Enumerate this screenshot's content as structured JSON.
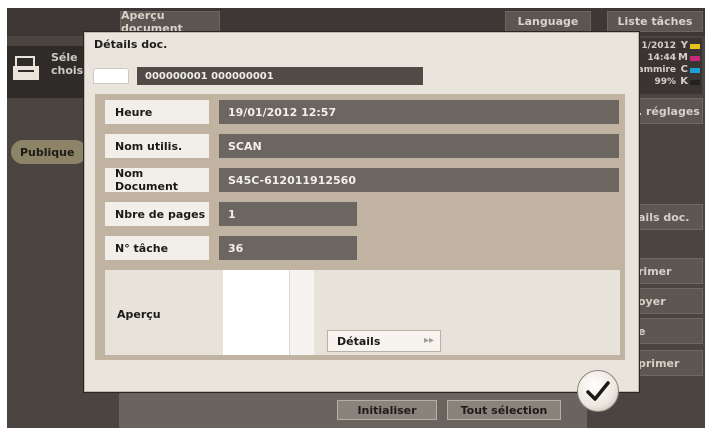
{
  "background": {
    "top_buttons": [
      "Aperçu document",
      "Language",
      "Liste tâches"
    ],
    "left_text": [
      "Séle",
      "choisi"
    ],
    "public_tab": "Publique",
    "status": {
      "lines": [
        "1/2012",
        "14:44",
        "ammire",
        "99%"
      ],
      "cmyk_labels": [
        "Y",
        "M",
        "C",
        "K"
      ],
      "cmyk_colors": [
        "#e6c21a",
        "#c8287a",
        "#1aa0d8",
        "#222222"
      ]
    },
    "right_buttons": [
      ". réglages",
      "ails doc.",
      "rimer",
      "oyer",
      "e",
      "primer"
    ],
    "bottom_buttons": [
      "Initialiser",
      "Tout sélection"
    ]
  },
  "dialog": {
    "title": "Détails doc.",
    "doc_id": "000000001 000000001",
    "fields": [
      {
        "label": "Heure",
        "value": "19/01/2012 12:57"
      },
      {
        "label": "Nom utilis.",
        "value": "SCAN"
      },
      {
        "label": "Nom Document",
        "value": "S45C-612011912560"
      },
      {
        "label": "Nbre de pages",
        "value": "1"
      },
      {
        "label": "N° tâche",
        "value": "36"
      }
    ],
    "preview_label": "Aperçu",
    "details_button": "Détails",
    "details_arrow": "▸▸"
  },
  "confirm_icon": "checkmark-icon"
}
